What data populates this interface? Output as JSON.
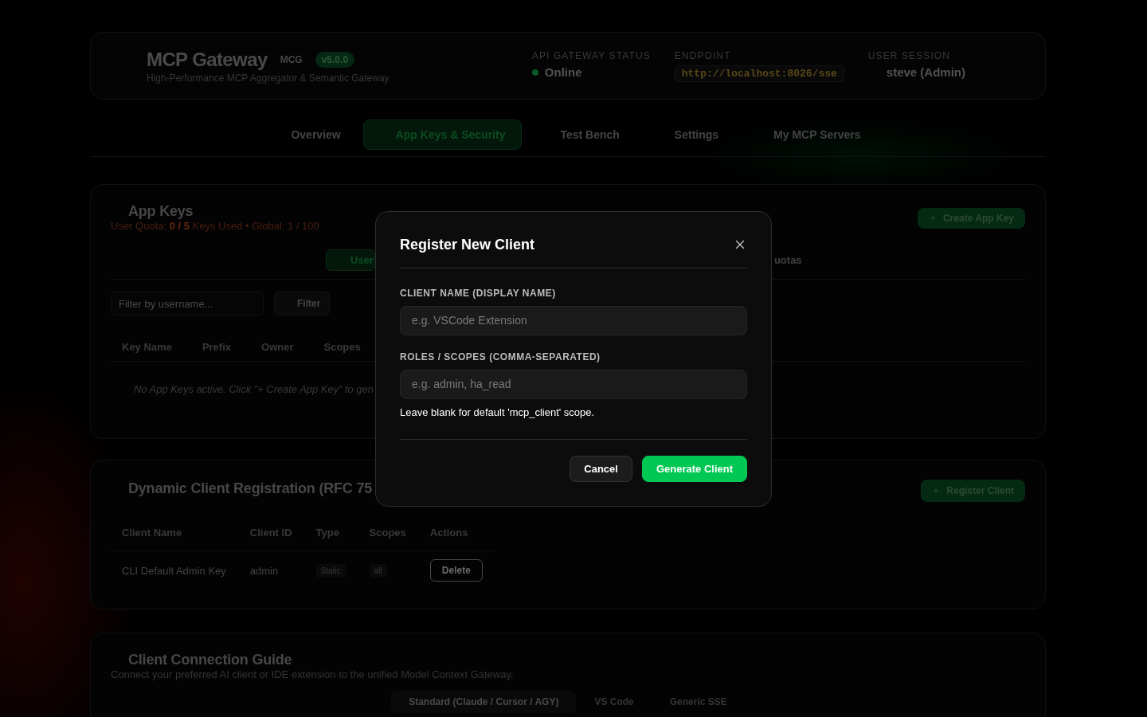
{
  "header": {
    "title": "MCP Gateway",
    "code": "MCG",
    "version": "v5.0.0",
    "subtitle": "High-Performance MCP Aggregator & Semantic Gateway",
    "stats": [
      {
        "kind": "status",
        "label": "API GATEWAY STATUS",
        "value": "Online",
        "online": true
      },
      {
        "kind": "code",
        "label": "ENDPOINT",
        "value": "http://localhost:8026/sse"
      },
      {
        "kind": "text",
        "label": "USER SESSION",
        "value": "steve (Admin)"
      }
    ]
  },
  "nav": {
    "tabs": [
      {
        "label": "Overview",
        "selected": false
      },
      {
        "label": "App Keys & Security",
        "selected": true
      },
      {
        "label": "Test Bench",
        "selected": false
      },
      {
        "label": "Settings",
        "selected": false
      },
      {
        "label": "My MCP Servers",
        "selected": false
      }
    ]
  },
  "app_keys": {
    "title": "App Keys",
    "quota": "User Quota: **0 / 5** Keys Used • Global: 1 / 100",
    "create_button": "Create App Key",
    "tabs": [
      {
        "label": "User",
        "selected": true
      },
      {
        "label": "uotas",
        "selected": false
      }
    ],
    "filter": {
      "placeholder": "Filter by username...",
      "button": "Filter"
    },
    "table": {
      "columns": [
        "Key Name",
        "Prefix",
        "Owner",
        "Scopes"
      ],
      "empty_message": "No App Keys active. Click \"+ Create App Key\" to gen"
    }
  },
  "client_registration": {
    "title": "Dynamic Client Registration (RFC 75",
    "register_button": "Register Client",
    "table": {
      "columns": [
        "Client Name",
        "Client ID",
        "Type",
        "Scopes",
        "Actions"
      ],
      "rows": [
        {
          "client_name": "CLI Default Admin Key",
          "client_id": "admin",
          "type": "Static",
          "scopes": "all",
          "action": "Delete"
        }
      ]
    }
  },
  "connection_guide": {
    "title": "Client Connection Guide",
    "description": "Connect your preferred AI client or IDE extension to the unified Model Context Gateway.",
    "tabs": [
      {
        "label": "Standard (Claude / Cursor / AGY)",
        "selected": true
      },
      {
        "label": "VS Code",
        "selected": false
      },
      {
        "label": "Generic SSE",
        "selected": false
      }
    ]
  },
  "modal": {
    "title": "Register New Client",
    "fields": [
      {
        "label": "CLIENT NAME (DISPLAY NAME)",
        "placeholder": "e.g. VSCode Extension"
      },
      {
        "label": "ROLES / SCOPES (COMMA-SEPARATED)",
        "placeholder": "e.g. admin, ha_read",
        "help": "Leave blank for default 'mcp_client' scope."
      }
    ],
    "buttons": [
      {
        "label": "Cancel",
        "kind": "secondary"
      },
      {
        "label": "Generate Client",
        "kind": "primary"
      }
    ]
  }
}
